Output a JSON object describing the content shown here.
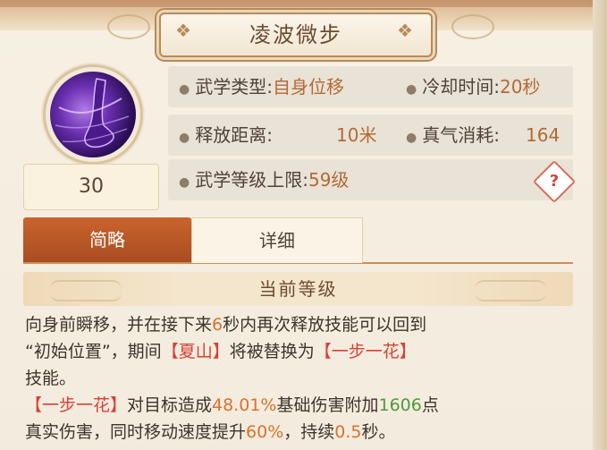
{
  "skill": {
    "name": "凌波微步",
    "level": "30",
    "icon": "skill-feet-icon"
  },
  "stats": {
    "type_label": "武学类型:",
    "type_value": "自身位移",
    "cooldown_label": "冷却时间:",
    "cooldown_value": "20秒",
    "range_label": "释放距离:",
    "range_value": "10米",
    "qi_label": "真气消耗:",
    "qi_value": "164",
    "max_level_label": "武学等级上限:",
    "max_level_value": "59级",
    "help_symbol": "?"
  },
  "tabs": {
    "brief": "简略",
    "detail": "详细"
  },
  "section": {
    "current_level": "当前等级"
  },
  "description": {
    "l1_a": "向身前瞬移，并在接下来",
    "l1_b": "6",
    "l1_c": "秒内再次释放技能可以回到",
    "l2_a": "“初始位置”，期间",
    "l2_b": "【夏山】",
    "l2_c": "将被替换为",
    "l2_d": "【一步一花】",
    "l3": "技能。",
    "l4_a": "【一步一花】",
    "l4_b": "对目标造成",
    "l4_c": "48.01%",
    "l4_d": "基础伤害附加",
    "l4_e": "1606",
    "l4_f": "点",
    "l5_a": "真实伤害，同时移动速度提升",
    "l5_b": "60%",
    "l5_c": "，持续",
    "l5_d": "0.5",
    "l5_e": "秒。"
  },
  "colors": {
    "accent": "#c9642d",
    "value": "#b36a35",
    "highlight_red": "#d64136",
    "highlight_orange": "#d9722d",
    "highlight_green": "#4f9a3f"
  }
}
